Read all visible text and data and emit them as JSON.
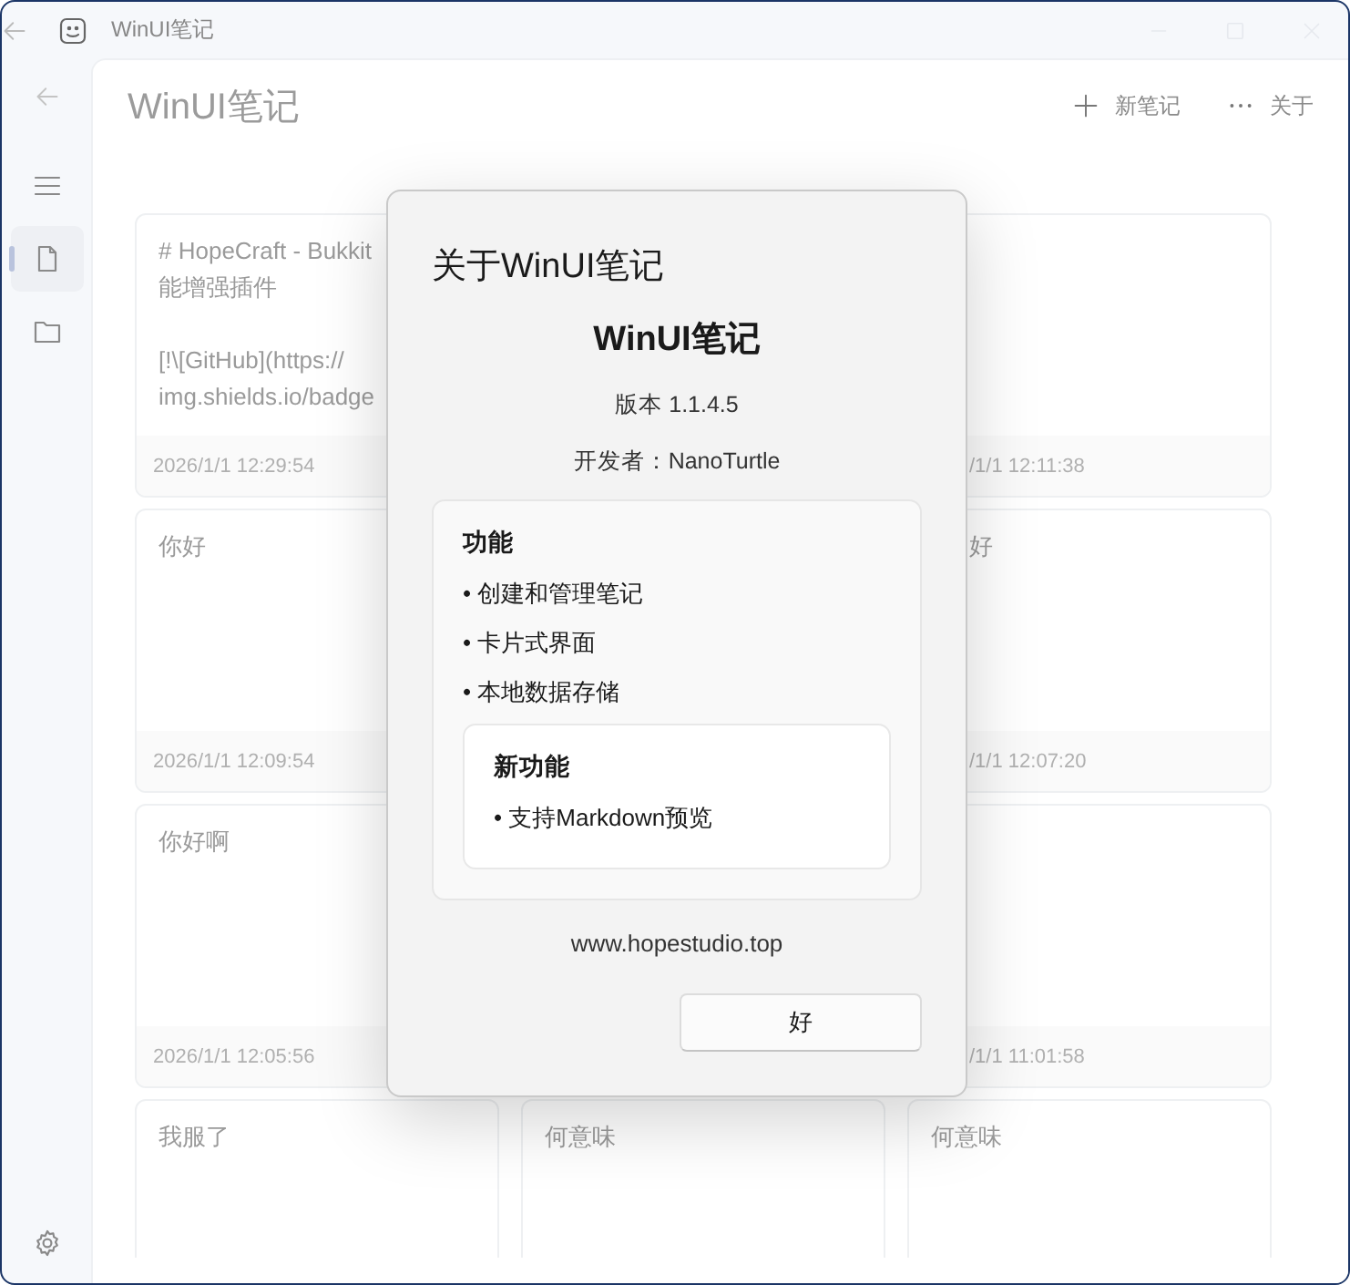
{
  "window": {
    "title": "WinUI笔记"
  },
  "nav": {
    "items": [
      {
        "kind": "menu",
        "selected": false
      },
      {
        "kind": "notes",
        "selected": true
      },
      {
        "kind": "folder",
        "selected": false
      }
    ]
  },
  "page": {
    "title": "WinUI笔记",
    "commands": [
      {
        "kind": "add",
        "label": "新笔记"
      },
      {
        "kind": "more",
        "label": "关于"
      }
    ]
  },
  "card_rows": [
    {
      "column_1": {
        "paragraphs": [
          [
            "# HopeCraft - Bukkit",
            "能增强插件"
          ],
          [
            "[!\\[GitHub](https://",
            "img.shields.io/badge"
          ]
        ],
        "timestamp": "2026/1/1 12:29:54"
      },
      "column_3": {
        "timestamp": "/1/1 12:11:38"
      }
    },
    {
      "column_1": {
        "paragraphs": [
          [
            "你好"
          ]
        ],
        "timestamp": "2026/1/1 12:09:54"
      },
      "column_3": {
        "paragraphs": [
          [
            "好"
          ]
        ],
        "timestamp": "/1/1 12:07:20"
      }
    },
    {
      "column_1": {
        "paragraphs": [
          [
            "你好啊"
          ]
        ],
        "timestamp": "2026/1/1 12:05:56"
      },
      "column_3": {
        "timestamp": "/1/1 11:01:58"
      }
    },
    {
      "column_1": {
        "paragraphs": [
          [
            "我服了"
          ]
        ]
      },
      "column_2": {
        "paragraphs": [
          [
            "何意味"
          ]
        ]
      },
      "column_3": {
        "paragraphs": [
          [
            "何意味"
          ]
        ]
      }
    }
  ],
  "dialog": {
    "title": "关于WinUI笔记",
    "app_name": "WinUI笔记",
    "version": "版本 1.1.4.5",
    "developer": "开发者：NanoTurtle",
    "features": {
      "heading": "功能",
      "items": [
        "• 创建和管理笔记",
        "• 卡片式界面",
        "• 本地数据存储"
      ],
      "new_features": {
        "heading": "新功能",
        "items": [
          "• 支持Markdown预览"
        ]
      }
    },
    "website": "www.hopestudio.top",
    "buttons": [
      {
        "label": "好"
      }
    ]
  }
}
